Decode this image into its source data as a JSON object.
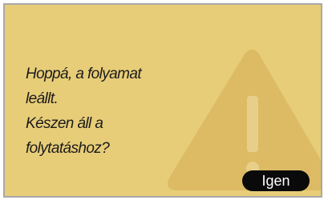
{
  "dialog": {
    "message_lines": [
      "Hoppá, a folyamat",
      "leállt.",
      "Készen áll a",
      "folytatáshoz?"
    ],
    "confirm_label": "Igen",
    "background_icon": "warning-triangle-icon"
  },
  "colors": {
    "dialog_background": "#e8cd78",
    "dialog_border": "#a8a8a8",
    "icon_fill": "#d9b45f",
    "text": "#1b1b1b",
    "button_background": "#0a0a0a",
    "button_text": "#ffffff"
  }
}
